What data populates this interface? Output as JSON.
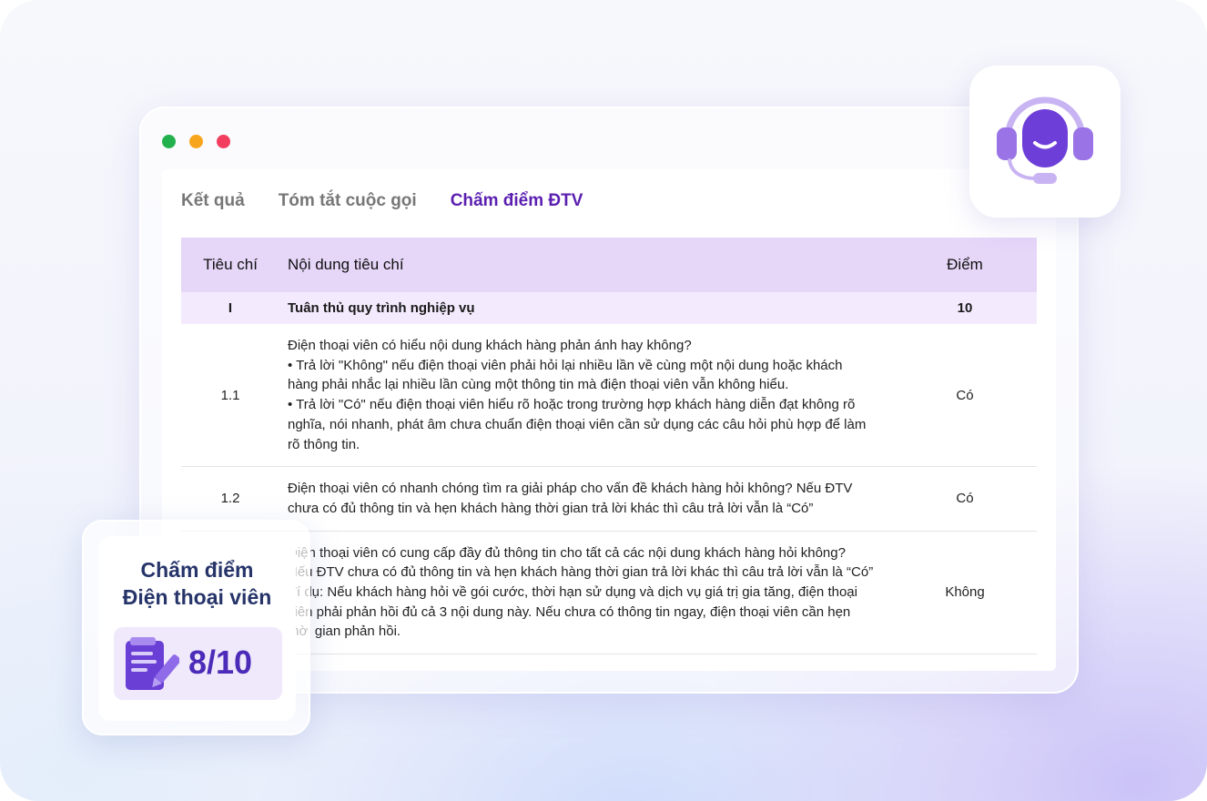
{
  "tabs": [
    {
      "label": "Kết quả"
    },
    {
      "label": "Tóm tắt cuộc gọi"
    },
    {
      "label": "Chấm điểm ĐTV"
    }
  ],
  "table": {
    "headers": [
      "Tiêu chí",
      "Nội dung tiêu chí",
      "Điểm"
    ],
    "section": {
      "id": "I",
      "content": "Tuân thủ quy trình nghiệp vụ",
      "score": "10"
    },
    "rows": [
      {
        "id": "1.1",
        "lines": [
          "Điện thoại viên có hiểu nội dung khách hàng phản ánh hay không?",
          " • Trả lời \"Không\" nếu điện thoại viên phải hỏi lại nhiều lần về cùng một nội dung hoặc khách",
          "hàng phải nhắc lại nhiều lần cùng một thông tin mà điện thoại viên vẫn không hiểu.",
          " • Trả lời \"Có\" nếu điện thoại viên hiểu rõ hoặc trong trường hợp khách hàng diễn đạt không rõ",
          "nghĩa, nói nhanh, phát âm chưa chuẩn điện thoại viên cần sử dụng các câu hỏi phù hợp để làm",
          "rõ thông tin."
        ],
        "score": "Có"
      },
      {
        "id": "1.2",
        "lines": [
          "Điện thoại viên có nhanh chóng tìm ra giải pháp cho vấn đề khách hàng hỏi không? Nếu ĐTV",
          "chưa có đủ thông tin và hẹn khách hàng thời gian trả lời khác thì câu trả lời vẫn là “Có”"
        ],
        "score": "Có"
      },
      {
        "id": "",
        "lines": [
          "Điện thoại viên có cung cấp đầy đủ thông tin cho tất cả các nội dung khách hàng hỏi không?",
          "Nếu ĐTV chưa có đủ thông tin và hẹn khách hàng thời gian trả lời khác thì câu trả lời vẫn là “Có”",
          "Ví dụ: Nếu khách hàng hỏi về gói cước, thời hạn sử dụng và dịch vụ giá trị gia tăng, điện thoại",
          "viên phải phản hồi đủ cả 3 nội dung này. Nếu chưa có thông tin ngay, điện thoại viên cần hẹn",
          "thời gian phản hồi."
        ],
        "score": "Không"
      }
    ]
  },
  "score_card": {
    "title_line1": "Chấm điểm",
    "title_line2": "Điện thoại viên",
    "value": "8/10"
  },
  "icons": {
    "headset": "headset-agent-icon",
    "clipboard": "clipboard-pen-icon"
  },
  "colors": {
    "accent": "#5b1fb0",
    "header_bg": "#e6d6f8",
    "section_bg": "#f3ebfd",
    "score_text": "#4b2bb8",
    "title_text": "#26346a"
  }
}
